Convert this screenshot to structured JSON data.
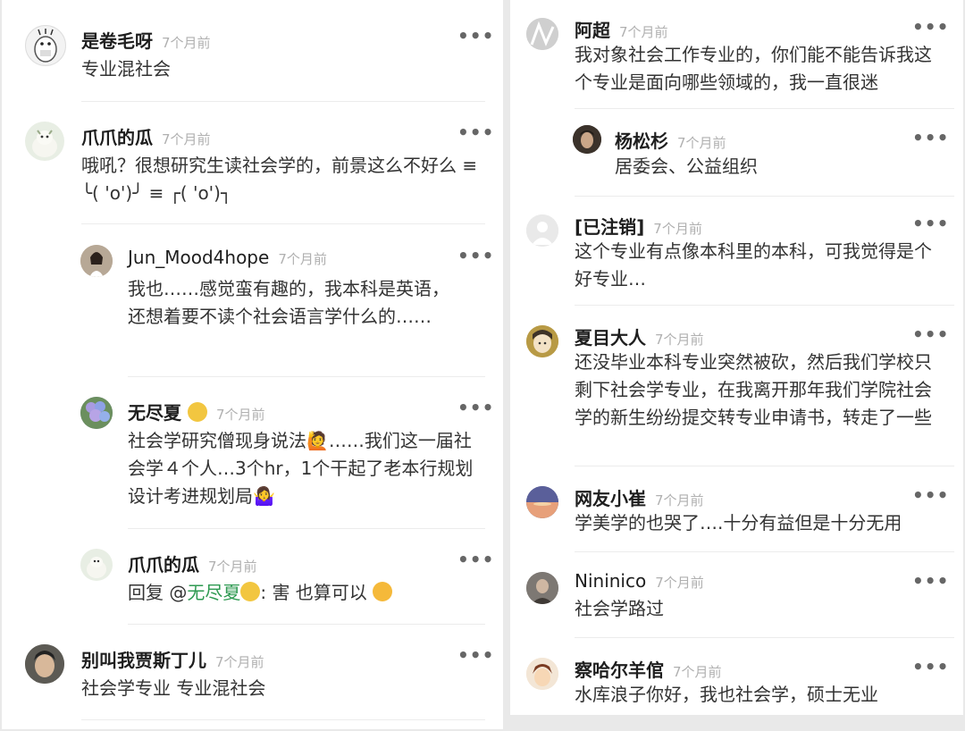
{
  "time_label": "7个月前",
  "more_label": "•••",
  "left": [
    {
      "name": "是卷毛呀",
      "body": "专业混社会"
    },
    {
      "name": "爪爪的瓜",
      "body": "哦吼？很想研究生读社会学的，前景这么不好么 ≡ ╰( 'o')╯ ≡ ┌( 'o')┐"
    },
    {
      "name": "Jun_Mood4hope",
      "body": "我也……感觉蛮有趣的，我本科是英语，还想着要不读个社会语言学什么的……"
    },
    {
      "name": "无尽夏",
      "body": "社会学研究僧现身说法🙋……我们这一届社会学４个人…3个hr，1个干起了老本行规划设计考进规划局🤷‍♀"
    },
    {
      "name": "爪爪的瓜",
      "reply_prefix": "回复 @",
      "mention": "无尽夏",
      "reply_text": ": 害 也算可以"
    },
    {
      "name": "别叫我贾斯丁儿",
      "body": "社会学专业 专业混社会"
    }
  ],
  "right": [
    {
      "name": "阿超",
      "body": "我对象社会工作专业的，你们能不能告诉我这个专业是面向哪些领域的，我一直很迷"
    },
    {
      "name": "杨松杉",
      "body": "居委会、公益组织"
    },
    {
      "name": "[已注销]",
      "body": "这个专业有点像本科里的本科，可我觉得是个好专业…"
    },
    {
      "name": "夏目大人",
      "body": "还没毕业本科专业突然被砍，然后我们学校只剩下社会学专业，在我离开那年我们学院社会学的新生纷纷提交转专业申请书，转走了一些"
    },
    {
      "name": "网友小崔",
      "body": "学美学的也哭了….十分有益但是十分无用"
    },
    {
      "name": "Nininico",
      "body": "社会学路过"
    },
    {
      "name": "察哈尔羊倌",
      "body": "水库浪子你好，我也社会学，硕士无业"
    }
  ],
  "colors": {
    "mention": "#2f9a52",
    "time": "#b0b0b0"
  }
}
